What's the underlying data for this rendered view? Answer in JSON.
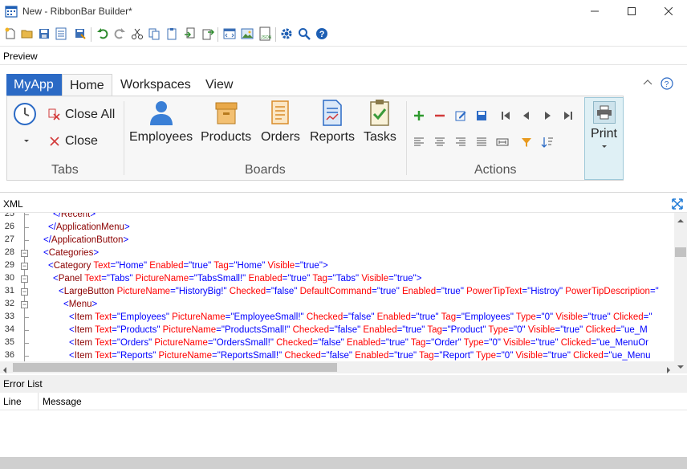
{
  "window": {
    "title": "New - RibbonBar Builder*"
  },
  "toolbar": {
    "icons": [
      "new-icon",
      "open-icon",
      "save-icon",
      "save-as-icon",
      "save-all-icon",
      "undo-icon",
      "redo-icon",
      "cut-icon",
      "copy-icon",
      "paste-icon",
      "import-icon",
      "export-icon",
      "code-view-icon",
      "image-icon",
      "json-icon",
      "settings-icon",
      "search-icon",
      "help-icon"
    ]
  },
  "preview": {
    "header": "Preview"
  },
  "ribbon": {
    "app_tab": "MyApp",
    "tabs": [
      {
        "label": "Home",
        "active": true
      },
      {
        "label": "Workspaces",
        "active": false
      },
      {
        "label": "View",
        "active": false
      }
    ],
    "groups": {
      "tabs": {
        "label": "Tabs",
        "close_all": "Close All",
        "close": "Close"
      },
      "boards": {
        "label": "Boards",
        "buttons": [
          "Employees",
          "Products",
          "Orders",
          "Reports",
          "Tasks"
        ]
      },
      "actions": {
        "label": "Actions"
      },
      "print": {
        "label": "Print"
      }
    }
  },
  "xml": {
    "header": "XML",
    "lines": [
      {
        "num": "25",
        "text": "</Recent>"
      },
      {
        "num": "26",
        "text": "</ApplicationMenu>"
      },
      {
        "num": "27",
        "text": "</ApplicationButton>"
      },
      {
        "num": "28",
        "text": "<Categories>"
      },
      {
        "num": "29",
        "tag": "Category",
        "attrs": [
          [
            "Text",
            "Home"
          ],
          [
            "Enabled",
            "true"
          ],
          [
            "Tag",
            "Home"
          ],
          [
            "Visible",
            "true"
          ]
        ]
      },
      {
        "num": "30",
        "tag": "Panel",
        "attrs": [
          [
            "Text",
            "Tabs"
          ],
          [
            "PictureName",
            "TabsSmall!"
          ],
          [
            "Enabled",
            "true"
          ],
          [
            "Tag",
            "Tabs"
          ],
          [
            "Visible",
            "true"
          ]
        ]
      },
      {
        "num": "31",
        "tag": "LargeButton",
        "attrs": [
          [
            "PictureName",
            "HistoryBig!"
          ],
          [
            "Checked",
            "false"
          ],
          [
            "DefaultCommand",
            "true"
          ],
          [
            "Enabled",
            "true"
          ],
          [
            "PowerTipText",
            "Histroy"
          ],
          [
            "PowerTipDescription",
            ""
          ]
        ]
      },
      {
        "num": "32",
        "text": "<Menu>"
      },
      {
        "num": "33",
        "tag": "Item",
        "attrs": [
          [
            "Text",
            "Employees"
          ],
          [
            "PictureName",
            "EmployeeSmall!"
          ],
          [
            "Checked",
            "false"
          ],
          [
            "Enabled",
            "true"
          ],
          [
            "Tag",
            "Employees"
          ],
          [
            "Type",
            "0"
          ],
          [
            "Visible",
            "true"
          ],
          [
            "Clicked",
            ""
          ]
        ]
      },
      {
        "num": "34",
        "tag": "Item",
        "attrs": [
          [
            "Text",
            "Products"
          ],
          [
            "PictureName",
            "ProductsSmall!"
          ],
          [
            "Checked",
            "false"
          ],
          [
            "Enabled",
            "true"
          ],
          [
            "Tag",
            "Product"
          ],
          [
            "Type",
            "0"
          ],
          [
            "Visible",
            "true"
          ],
          [
            "Clicked",
            "ue_M"
          ]
        ]
      },
      {
        "num": "35",
        "tag": "Item",
        "attrs": [
          [
            "Text",
            "Orders"
          ],
          [
            "PictureName",
            "OrdersSmall!"
          ],
          [
            "Checked",
            "false"
          ],
          [
            "Enabled",
            "true"
          ],
          [
            "Tag",
            "Order"
          ],
          [
            "Type",
            "0"
          ],
          [
            "Visible",
            "true"
          ],
          [
            "Clicked",
            "ue_MenuOr"
          ]
        ]
      },
      {
        "num": "36",
        "tag": "Item",
        "attrs": [
          [
            "Text",
            "Reports"
          ],
          [
            "PictureName",
            "ReportsSmall!"
          ],
          [
            "Checked",
            "false"
          ],
          [
            "Enabled",
            "true"
          ],
          [
            "Tag",
            "Report"
          ],
          [
            "Type",
            "0"
          ],
          [
            "Visible",
            "true"
          ],
          [
            "Clicked",
            "ue_Menu"
          ]
        ]
      }
    ]
  },
  "error_list": {
    "header": "Error List",
    "columns": [
      "Line",
      "Message"
    ]
  },
  "colors": {
    "myapp_tab": "#2b6ac5",
    "accent_blue": "#1e7ad6",
    "tag": "#8b0000",
    "attr": "#ff0000",
    "value": "#0000ff"
  }
}
